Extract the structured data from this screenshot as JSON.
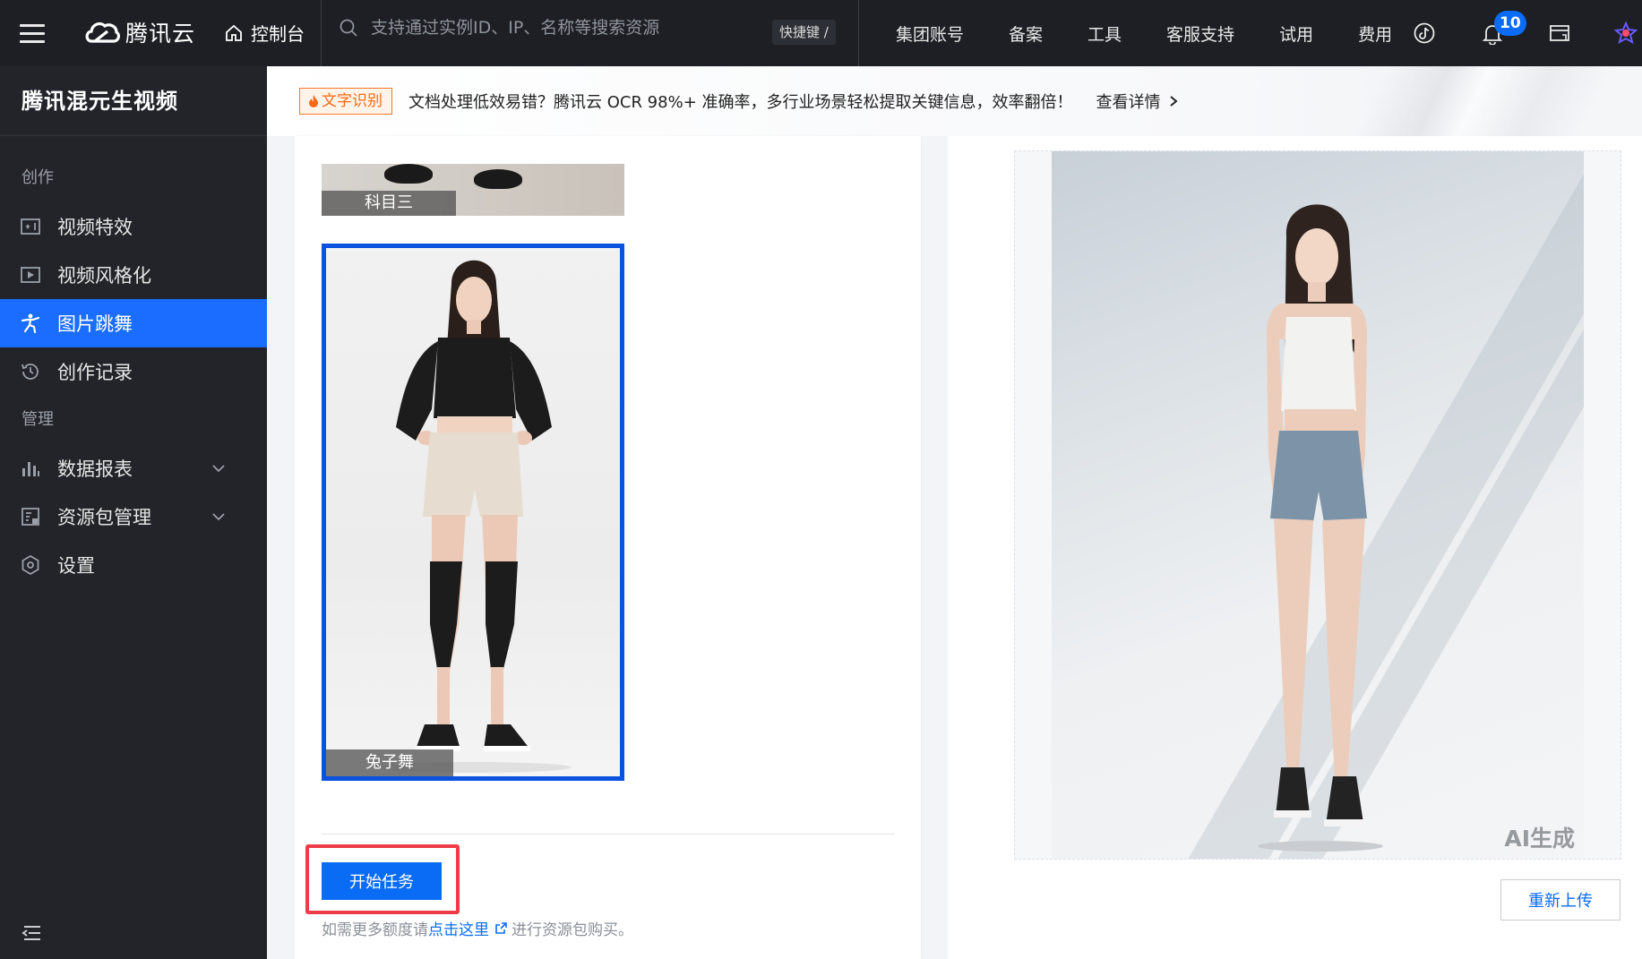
{
  "header": {
    "brand": "腾讯云",
    "console_label": "控制台",
    "search_placeholder": "支持通过实例ID、IP、名称等搜索资源",
    "shortcut_label": "快捷键 /",
    "nav": [
      "集团账号",
      "备案",
      "工具",
      "客服支持",
      "试用",
      "费用"
    ],
    "notification_count": "10"
  },
  "sidebar": {
    "title": "腾讯混元生视频",
    "groups": [
      {
        "label": "创作",
        "items": [
          {
            "label": "视频特效",
            "icon": "video-effects-icon",
            "active": false
          },
          {
            "label": "视频风格化",
            "icon": "video-stylize-icon",
            "active": false
          },
          {
            "label": "图片跳舞",
            "icon": "dance-figure-icon",
            "active": true
          },
          {
            "label": "创作记录",
            "icon": "history-icon",
            "active": false
          }
        ]
      },
      {
        "label": "管理",
        "items": [
          {
            "label": "数据报表",
            "icon": "bar-chart-icon",
            "expandable": true
          },
          {
            "label": "资源包管理",
            "icon": "package-icon",
            "expandable": true
          },
          {
            "label": "设置",
            "icon": "settings-icon",
            "expandable": false
          }
        ]
      }
    ]
  },
  "banner": {
    "tag": "文字识别",
    "text": "文档处理低效易错？腾讯云 OCR 98%+ 准确率，多行业场景轻松提取关键信息，效率翻倍！",
    "link": "查看详情"
  },
  "templates": [
    {
      "label": "科目三",
      "selected": false
    },
    {
      "label": "兔子舞",
      "selected": true
    }
  ],
  "actions": {
    "start_label": "开始任务",
    "quota_prefix": "如需更多额度请",
    "quota_link": "点击这里",
    "quota_suffix": "进行资源包购买。",
    "reupload_label": "重新上传"
  },
  "preview": {
    "watermark": "AI生成"
  },
  "colors": {
    "primary": "#0a6cf5",
    "highlight": "#ee3d48",
    "sidebar_bg": "#22242a",
    "topbar_bg": "#1d1f24",
    "tag_orange": "#ff6a13"
  }
}
